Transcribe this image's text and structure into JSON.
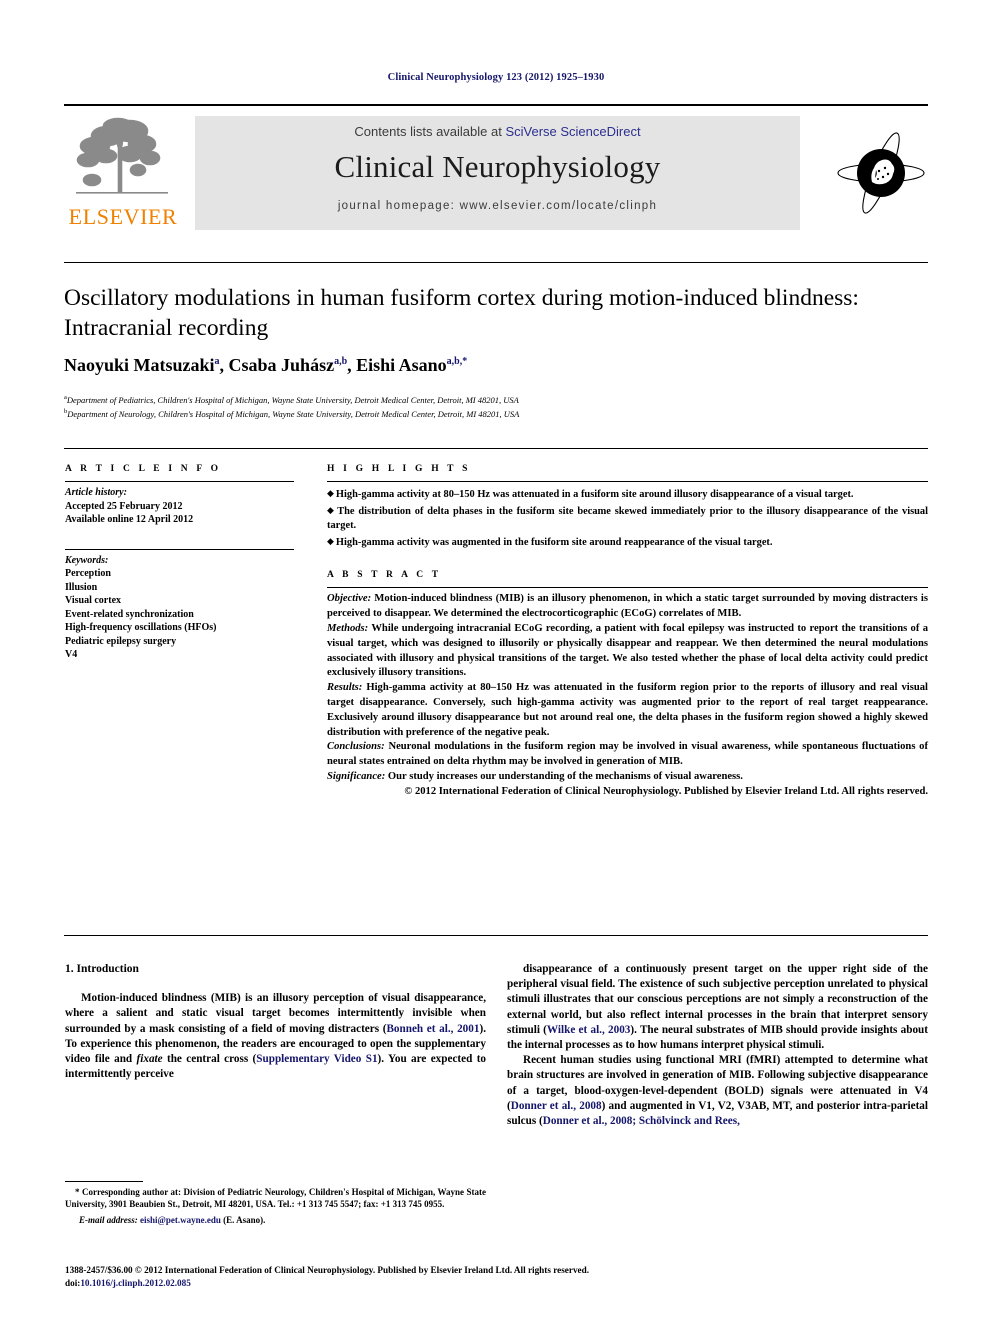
{
  "running_head": "Clinical Neurophysiology 123 (2012) 1925–1930",
  "masthead": {
    "publisher_name": "ELSEVIER",
    "contents_prefix": "Contents lists available at ",
    "contents_link": "SciVerse ScienceDirect",
    "journal_title": "Clinical Neurophysiology",
    "journal_homepage": "journal homepage: www.elsevier.com/locate/clinph"
  },
  "article": {
    "title": "Oscillatory modulations in human fusiform cortex during motion-induced blindness: Intracranial recording",
    "authors_html": "Naoyuki Matsuzaki<sup>a</sup>, Csaba Juhász<sup>a,b</sup>, Eishi Asano<sup>a,b,</sup><sup>*</sup>",
    "affiliation_a": "Department of Pediatrics, Children's Hospital of Michigan, Wayne State University, Detroit Medical Center, Detroit, MI 48201, USA",
    "affiliation_b": "Department of Neurology, Children's Hospital of Michigan, Wayne State University, Detroit Medical Center, Detroit, MI 48201, USA"
  },
  "info": {
    "heading": "A R T I C L E   I N F O",
    "history_label": "Article history:",
    "history_lines": [
      "Accepted 25 February 2012",
      "Available online 12 April 2012"
    ],
    "keywords_label": "Keywords:",
    "keywords": [
      "Perception",
      "Illusion",
      "Visual cortex",
      "Event-related synchronization",
      "High-frequency oscillations (HFOs)",
      "Pediatric epilepsy surgery",
      "V4"
    ]
  },
  "highlights": {
    "heading": "H I G H L I G H T S",
    "items": [
      "High-gamma activity at 80–150 Hz was attenuated in a fusiform site around illusory disappearance of a visual target.",
      "The distribution of delta phases in the fusiform site became skewed immediately prior to the illusory disappearance of the visual target.",
      "High-gamma activity was augmented in the fusiform site around reappearance of the visual target."
    ]
  },
  "abstract": {
    "heading": "A B S T R A C T",
    "objective_label": "Objective:",
    "objective_text": " Motion-induced blindness (MIB) is an illusory phenomenon, in which a static target surrounded by moving distracters is perceived to disappear. We determined the electrocorticographic (ECoG) correlates of MIB.",
    "methods_label": "Methods:",
    "methods_text": " While undergoing intracranial ECoG recording, a patient with focal epilepsy was instructed to report the transitions of a visual target, which was designed to illusorily or physically disappear and reappear. We then determined the neural modulations associated with illusory and physical transitions of the target. We also tested whether the phase of local delta activity could predict exclusively illusory transitions.",
    "results_label": "Results:",
    "results_text": " High-gamma activity at 80–150 Hz was attenuated in the fusiform region prior to the reports of illusory and real visual target disappearance. Conversely, such high-gamma activity was augmented prior to the report of real target reappearance. Exclusively around illusory disappearance but not around real one, the delta phases in the fusiform region showed a highly skewed distribution with preference of the negative peak.",
    "conclusions_label": "Conclusions:",
    "conclusions_text": " Neuronal modulations in the fusiform region may be involved in visual awareness, while spontaneous fluctuations of neural states entrained on delta rhythm may be involved in generation of MIB.",
    "significance_label": "Significance:",
    "significance_text": " Our study increases our understanding of the mechanisms of visual awareness.",
    "copyright": "© 2012 International Federation of Clinical Neurophysiology. Published by Elsevier Ireland Ltd. All rights reserved."
  },
  "body": {
    "section_heading": "1. Introduction",
    "left_paragraph_1_part1": "Motion-induced blindness (MIB) is an illusory perception of visual disappearance, where a salient and static visual target becomes intermittently invisible when surrounded by a mask consisting of a field of moving distracters (",
    "left_citation_1": "Bonneh et al., 2001",
    "left_paragraph_1_part2": "). To experience this phenomenon, the readers are encouraged to open the supplementary video file and ",
    "left_italic_1": "fixate",
    "left_paragraph_1_part3": " the central cross (",
    "left_citation_2": "Supplementary Video S1",
    "left_paragraph_1_part4": "). You are expected to intermittently perceive",
    "right_paragraph_1_part1": "disappearance of a continuously present target on the upper right side of the peripheral visual field. The existence of such subjective perception unrelated to physical stimuli illustrates that our conscious perceptions are not simply a reconstruction of the external world, but also reflect internal processes in the brain that interpret sensory stimuli (",
    "right_citation_1": "Wilke et al., 2003",
    "right_paragraph_1_part2": "). The neural substrates of MIB should provide insights about the internal processes as to how humans interpret physical stimuli.",
    "right_paragraph_2_part1": "Recent human studies using functional MRI (fMRI) attempted to determine what brain structures are involved in generation of MIB. Following subjective disappearance of a target, blood-oxygen-level-dependent (BOLD) signals were attenuated in V4 (",
    "right_citation_2": "Donner et al., 2008",
    "right_paragraph_2_part2": ") and augmented in V1, V2, V3AB, MT, and posterior intra-parietal sulcus (",
    "right_citation_3": "Donner et al., 2008; Schölvinck and Rees,",
    "right_paragraph_2_part3": ""
  },
  "footnote": {
    "marker": "*",
    "corresponding_text": " Corresponding author at: Division of Pediatric Neurology, Children's Hospital of Michigan, Wayne State University, 3901 Beaubien St., Detroit, MI 48201, USA. Tel.: +1 313 745 5547; fax: +1 313 745 0955.",
    "email_label": "E-mail address:",
    "email_link": "eishi@pet.wayne.edu",
    "email_suffix": " (E. Asano)."
  },
  "footer": {
    "issn_line": "1388-2457/$36.00 © 2012 International Federation of Clinical Neurophysiology. Published by Elsevier Ireland Ltd. All rights reserved.",
    "doi_label": "doi:",
    "doi_value": "10.1016/j.clinph.2012.02.085"
  },
  "colors": {
    "link": "#15166b",
    "sciencedirect_link": "#2d2f8f",
    "elsevier_orange": "#f08000",
    "band_gray": "#e4e4e4"
  }
}
